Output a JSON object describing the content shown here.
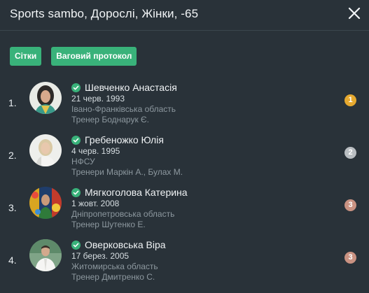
{
  "header": {
    "title": "Sports sambo, Дорослі, Жінки, -65"
  },
  "toolbar": {
    "brackets_label": "Сітки",
    "weigh_in_label": "Ваговий протокол"
  },
  "colors": {
    "background": "#293239",
    "accent": "#39b27a",
    "gold": "#e6a92f",
    "silver": "#b9bec2",
    "bronze": "#c99282"
  },
  "results": [
    {
      "place": "1.",
      "name": "Шевченко Анастасія",
      "dob": "21 черв. 1993",
      "region": "Івано-Франківська область",
      "coach": "Тренер Боднарук Є.",
      "medal": "1",
      "medal_type": "gold",
      "verified_icon": "check-circle-icon"
    },
    {
      "place": "2.",
      "name": "Гребеножко Юлія",
      "dob": "4 черв. 1995",
      "region": "НФСУ",
      "coach": "Тренери Маркін А.,  Булах М.",
      "medal": "2",
      "medal_type": "silver",
      "verified_icon": "check-circle-icon"
    },
    {
      "place": "3.",
      "name": "Мягкоголова Катерина",
      "dob": "1 жовт. 2008",
      "region": "Дніпропетровська область",
      "coach": "Тренер Шутенко Е.",
      "medal": "3",
      "medal_type": "bronze",
      "verified_icon": "check-circle-icon"
    },
    {
      "place": "4.",
      "name": "Оверковська Віра",
      "dob": "17 берез. 2005",
      "region": "Житомирська область",
      "coach": "Тренер Дмитренко С.",
      "medal": "3",
      "medal_type": "bronze",
      "verified_icon": "check-circle-icon"
    }
  ]
}
